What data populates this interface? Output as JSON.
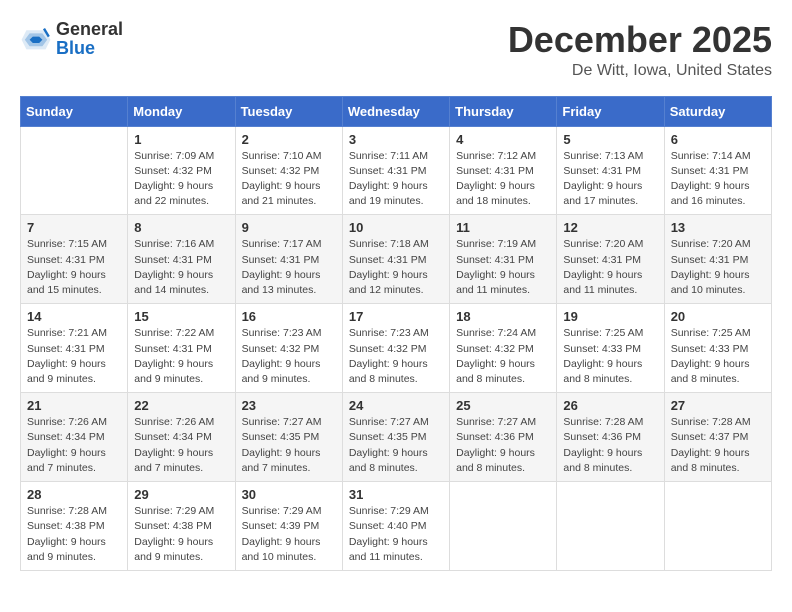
{
  "header": {
    "logo_general": "General",
    "logo_blue": "Blue",
    "month": "December 2025",
    "location": "De Witt, Iowa, United States"
  },
  "weekdays": [
    "Sunday",
    "Monday",
    "Tuesday",
    "Wednesday",
    "Thursday",
    "Friday",
    "Saturday"
  ],
  "weeks": [
    [
      {
        "day": "",
        "info": ""
      },
      {
        "day": "1",
        "info": "Sunrise: 7:09 AM\nSunset: 4:32 PM\nDaylight: 9 hours\nand 22 minutes."
      },
      {
        "day": "2",
        "info": "Sunrise: 7:10 AM\nSunset: 4:32 PM\nDaylight: 9 hours\nand 21 minutes."
      },
      {
        "day": "3",
        "info": "Sunrise: 7:11 AM\nSunset: 4:31 PM\nDaylight: 9 hours\nand 19 minutes."
      },
      {
        "day": "4",
        "info": "Sunrise: 7:12 AM\nSunset: 4:31 PM\nDaylight: 9 hours\nand 18 minutes."
      },
      {
        "day": "5",
        "info": "Sunrise: 7:13 AM\nSunset: 4:31 PM\nDaylight: 9 hours\nand 17 minutes."
      },
      {
        "day": "6",
        "info": "Sunrise: 7:14 AM\nSunset: 4:31 PM\nDaylight: 9 hours\nand 16 minutes."
      }
    ],
    [
      {
        "day": "7",
        "info": "Sunrise: 7:15 AM\nSunset: 4:31 PM\nDaylight: 9 hours\nand 15 minutes."
      },
      {
        "day": "8",
        "info": "Sunrise: 7:16 AM\nSunset: 4:31 PM\nDaylight: 9 hours\nand 14 minutes."
      },
      {
        "day": "9",
        "info": "Sunrise: 7:17 AM\nSunset: 4:31 PM\nDaylight: 9 hours\nand 13 minutes."
      },
      {
        "day": "10",
        "info": "Sunrise: 7:18 AM\nSunset: 4:31 PM\nDaylight: 9 hours\nand 12 minutes."
      },
      {
        "day": "11",
        "info": "Sunrise: 7:19 AM\nSunset: 4:31 PM\nDaylight: 9 hours\nand 11 minutes."
      },
      {
        "day": "12",
        "info": "Sunrise: 7:20 AM\nSunset: 4:31 PM\nDaylight: 9 hours\nand 11 minutes."
      },
      {
        "day": "13",
        "info": "Sunrise: 7:20 AM\nSunset: 4:31 PM\nDaylight: 9 hours\nand 10 minutes."
      }
    ],
    [
      {
        "day": "14",
        "info": "Sunrise: 7:21 AM\nSunset: 4:31 PM\nDaylight: 9 hours\nand 9 minutes."
      },
      {
        "day": "15",
        "info": "Sunrise: 7:22 AM\nSunset: 4:31 PM\nDaylight: 9 hours\nand 9 minutes."
      },
      {
        "day": "16",
        "info": "Sunrise: 7:23 AM\nSunset: 4:32 PM\nDaylight: 9 hours\nand 9 minutes."
      },
      {
        "day": "17",
        "info": "Sunrise: 7:23 AM\nSunset: 4:32 PM\nDaylight: 9 hours\nand 8 minutes."
      },
      {
        "day": "18",
        "info": "Sunrise: 7:24 AM\nSunset: 4:32 PM\nDaylight: 9 hours\nand 8 minutes."
      },
      {
        "day": "19",
        "info": "Sunrise: 7:25 AM\nSunset: 4:33 PM\nDaylight: 9 hours\nand 8 minutes."
      },
      {
        "day": "20",
        "info": "Sunrise: 7:25 AM\nSunset: 4:33 PM\nDaylight: 9 hours\nand 8 minutes."
      }
    ],
    [
      {
        "day": "21",
        "info": "Sunrise: 7:26 AM\nSunset: 4:34 PM\nDaylight: 9 hours\nand 7 minutes."
      },
      {
        "day": "22",
        "info": "Sunrise: 7:26 AM\nSunset: 4:34 PM\nDaylight: 9 hours\nand 7 minutes."
      },
      {
        "day": "23",
        "info": "Sunrise: 7:27 AM\nSunset: 4:35 PM\nDaylight: 9 hours\nand 7 minutes."
      },
      {
        "day": "24",
        "info": "Sunrise: 7:27 AM\nSunset: 4:35 PM\nDaylight: 9 hours\nand 8 minutes."
      },
      {
        "day": "25",
        "info": "Sunrise: 7:27 AM\nSunset: 4:36 PM\nDaylight: 9 hours\nand 8 minutes."
      },
      {
        "day": "26",
        "info": "Sunrise: 7:28 AM\nSunset: 4:36 PM\nDaylight: 9 hours\nand 8 minutes."
      },
      {
        "day": "27",
        "info": "Sunrise: 7:28 AM\nSunset: 4:37 PM\nDaylight: 9 hours\nand 8 minutes."
      }
    ],
    [
      {
        "day": "28",
        "info": "Sunrise: 7:28 AM\nSunset: 4:38 PM\nDaylight: 9 hours\nand 9 minutes."
      },
      {
        "day": "29",
        "info": "Sunrise: 7:29 AM\nSunset: 4:38 PM\nDaylight: 9 hours\nand 9 minutes."
      },
      {
        "day": "30",
        "info": "Sunrise: 7:29 AM\nSunset: 4:39 PM\nDaylight: 9 hours\nand 10 minutes."
      },
      {
        "day": "31",
        "info": "Sunrise: 7:29 AM\nSunset: 4:40 PM\nDaylight: 9 hours\nand 11 minutes."
      },
      {
        "day": "",
        "info": ""
      },
      {
        "day": "",
        "info": ""
      },
      {
        "day": "",
        "info": ""
      }
    ]
  ]
}
